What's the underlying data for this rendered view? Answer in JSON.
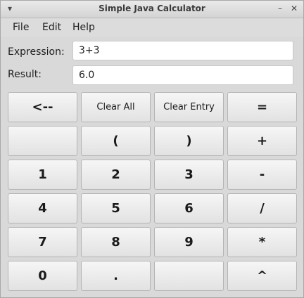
{
  "window": {
    "title": "Simple Java Calculator",
    "menu_glyph": "▾",
    "minimize_glyph": "–",
    "close_glyph": "✕"
  },
  "menubar": {
    "items": [
      "File",
      "Edit",
      "Help"
    ]
  },
  "form": {
    "expression_label": "Expression:",
    "expression_value": "3+3",
    "result_label": "Result:",
    "result_value": "6.0"
  },
  "keypad": {
    "rows": [
      [
        "<--",
        "Clear All",
        "Clear Entry",
        "="
      ],
      [
        "",
        "(",
        ")",
        "+"
      ],
      [
        "1",
        "2",
        "3",
        "-"
      ],
      [
        "4",
        "5",
        "6",
        "/"
      ],
      [
        "7",
        "8",
        "9",
        "*"
      ],
      [
        "0",
        ".",
        "",
        "^"
      ]
    ]
  }
}
